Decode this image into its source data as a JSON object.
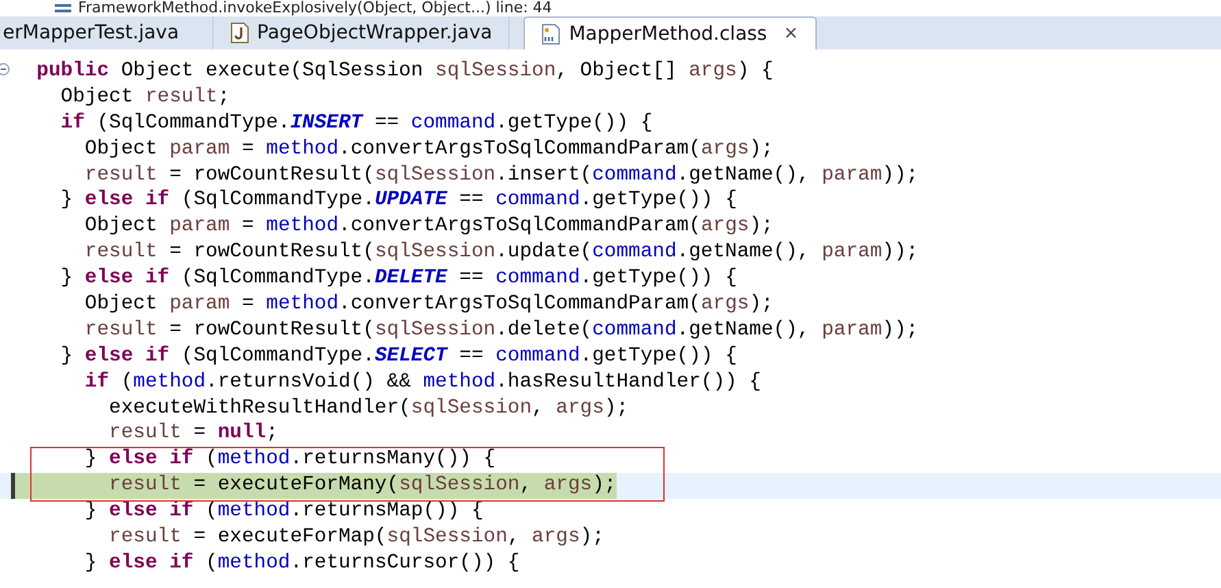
{
  "debug_frame": {
    "text": "FrameworkMethod.invokeExplosively(Object, Object...) line: 44"
  },
  "tabs": [
    {
      "label": "erMapperTest.java",
      "kind": "plain",
      "selected": false
    },
    {
      "label": "PageObjectWrapper.java",
      "kind": "java",
      "selected": false
    },
    {
      "label": "MapperMethod.class",
      "kind": "class",
      "selected": true,
      "close": "×"
    }
  ],
  "code": {
    "lines": [
      {
        "foldable": true,
        "tokens": [
          {
            "kind": "kw",
            "text": "  public"
          },
          {
            "kind": "plain",
            "text": " Object execute(SqlSession "
          },
          {
            "kind": "local",
            "text": "sqlSession"
          },
          {
            "kind": "plain",
            "text": ", Object[] "
          },
          {
            "kind": "local",
            "text": "args"
          },
          {
            "kind": "plain",
            "text": ") {"
          }
        ]
      },
      {
        "tokens": [
          {
            "kind": "plain",
            "text": "    Object "
          },
          {
            "kind": "local",
            "text": "result"
          },
          {
            "kind": "plain",
            "text": ";"
          }
        ]
      },
      {
        "tokens": [
          {
            "kind": "kw",
            "text": "    if"
          },
          {
            "kind": "plain",
            "text": " (SqlCommandType."
          },
          {
            "kind": "const",
            "text": "INSERT"
          },
          {
            "kind": "plain",
            "text": " == "
          },
          {
            "kind": "field",
            "text": "command"
          },
          {
            "kind": "plain",
            "text": ".getType()) {"
          }
        ]
      },
      {
        "tokens": [
          {
            "kind": "plain",
            "text": "      Object "
          },
          {
            "kind": "local",
            "text": "param"
          },
          {
            "kind": "plain",
            "text": " = "
          },
          {
            "kind": "field",
            "text": "method"
          },
          {
            "kind": "plain",
            "text": ".convertArgsToSqlCommandParam("
          },
          {
            "kind": "local",
            "text": "args"
          },
          {
            "kind": "plain",
            "text": ");"
          }
        ]
      },
      {
        "tokens": [
          {
            "kind": "local",
            "text": "      result"
          },
          {
            "kind": "plain",
            "text": " = rowCountResult("
          },
          {
            "kind": "local",
            "text": "sqlSession"
          },
          {
            "kind": "plain",
            "text": ".insert("
          },
          {
            "kind": "field",
            "text": "command"
          },
          {
            "kind": "plain",
            "text": ".getName(), "
          },
          {
            "kind": "local",
            "text": "param"
          },
          {
            "kind": "plain",
            "text": "));"
          }
        ]
      },
      {
        "tokens": [
          {
            "kind": "plain",
            "text": "    } "
          },
          {
            "kind": "kw",
            "text": "else if"
          },
          {
            "kind": "plain",
            "text": " (SqlCommandType."
          },
          {
            "kind": "const",
            "text": "UPDATE"
          },
          {
            "kind": "plain",
            "text": " == "
          },
          {
            "kind": "field",
            "text": "command"
          },
          {
            "kind": "plain",
            "text": ".getType()) {"
          }
        ]
      },
      {
        "tokens": [
          {
            "kind": "plain",
            "text": "      Object "
          },
          {
            "kind": "local",
            "text": "param"
          },
          {
            "kind": "plain",
            "text": " = "
          },
          {
            "kind": "field",
            "text": "method"
          },
          {
            "kind": "plain",
            "text": ".convertArgsToSqlCommandParam("
          },
          {
            "kind": "local",
            "text": "args"
          },
          {
            "kind": "plain",
            "text": ");"
          }
        ]
      },
      {
        "tokens": [
          {
            "kind": "local",
            "text": "      result"
          },
          {
            "kind": "plain",
            "text": " = rowCountResult("
          },
          {
            "kind": "local",
            "text": "sqlSession"
          },
          {
            "kind": "plain",
            "text": ".update("
          },
          {
            "kind": "field",
            "text": "command"
          },
          {
            "kind": "plain",
            "text": ".getName(), "
          },
          {
            "kind": "local",
            "text": "param"
          },
          {
            "kind": "plain",
            "text": "));"
          }
        ]
      },
      {
        "tokens": [
          {
            "kind": "plain",
            "text": "    } "
          },
          {
            "kind": "kw",
            "text": "else if"
          },
          {
            "kind": "plain",
            "text": " (SqlCommandType."
          },
          {
            "kind": "const",
            "text": "DELETE"
          },
          {
            "kind": "plain",
            "text": " == "
          },
          {
            "kind": "field",
            "text": "command"
          },
          {
            "kind": "plain",
            "text": ".getType()) {"
          }
        ]
      },
      {
        "tokens": [
          {
            "kind": "plain",
            "text": "      Object "
          },
          {
            "kind": "local",
            "text": "param"
          },
          {
            "kind": "plain",
            "text": " = "
          },
          {
            "kind": "field",
            "text": "method"
          },
          {
            "kind": "plain",
            "text": ".convertArgsToSqlCommandParam("
          },
          {
            "kind": "local",
            "text": "args"
          },
          {
            "kind": "plain",
            "text": ");"
          }
        ]
      },
      {
        "tokens": [
          {
            "kind": "local",
            "text": "      result"
          },
          {
            "kind": "plain",
            "text": " = rowCountResult("
          },
          {
            "kind": "local",
            "text": "sqlSession"
          },
          {
            "kind": "plain",
            "text": ".delete("
          },
          {
            "kind": "field",
            "text": "command"
          },
          {
            "kind": "plain",
            "text": ".getName(), "
          },
          {
            "kind": "local",
            "text": "param"
          },
          {
            "kind": "plain",
            "text": "));"
          }
        ]
      },
      {
        "tokens": [
          {
            "kind": "plain",
            "text": "    } "
          },
          {
            "kind": "kw",
            "text": "else if"
          },
          {
            "kind": "plain",
            "text": " (SqlCommandType."
          },
          {
            "kind": "const",
            "text": "SELECT"
          },
          {
            "kind": "plain",
            "text": " == "
          },
          {
            "kind": "field",
            "text": "command"
          },
          {
            "kind": "plain",
            "text": ".getType()) {"
          }
        ]
      },
      {
        "tokens": [
          {
            "kind": "kw",
            "text": "      if"
          },
          {
            "kind": "plain",
            "text": " ("
          },
          {
            "kind": "field",
            "text": "method"
          },
          {
            "kind": "plain",
            "text": ".returnsVoid() && "
          },
          {
            "kind": "field",
            "text": "method"
          },
          {
            "kind": "plain",
            "text": ".hasResultHandler()) {"
          }
        ]
      },
      {
        "tokens": [
          {
            "kind": "plain",
            "text": "        executeWithResultHandler("
          },
          {
            "kind": "local",
            "text": "sqlSession"
          },
          {
            "kind": "plain",
            "text": ", "
          },
          {
            "kind": "local",
            "text": "args"
          },
          {
            "kind": "plain",
            "text": ");"
          }
        ]
      },
      {
        "tokens": [
          {
            "kind": "local",
            "text": "        result"
          },
          {
            "kind": "plain",
            "text": " = "
          },
          {
            "kind": "kw",
            "text": "null"
          },
          {
            "kind": "plain",
            "text": ";"
          }
        ]
      },
      {
        "boxed": true,
        "tokens": [
          {
            "kind": "plain",
            "text": "      } "
          },
          {
            "kind": "kw",
            "text": "else if"
          },
          {
            "kind": "plain",
            "text": " ("
          },
          {
            "kind": "field",
            "text": "method"
          },
          {
            "kind": "plain",
            "text": ".returnsMany()) {"
          }
        ]
      },
      {
        "boxed": true,
        "current": true,
        "tokens": [
          {
            "kind": "local",
            "text": "        result"
          },
          {
            "kind": "plain",
            "text": " = executeForMany("
          },
          {
            "kind": "local",
            "text": "sqlSession"
          },
          {
            "kind": "plain",
            "text": ", "
          },
          {
            "kind": "local",
            "text": "args"
          },
          {
            "kind": "plain",
            "text": ");"
          }
        ]
      },
      {
        "tokens": [
          {
            "kind": "plain",
            "text": "      } "
          },
          {
            "kind": "kw",
            "text": "else if"
          },
          {
            "kind": "plain",
            "text": " ("
          },
          {
            "kind": "field",
            "text": "method"
          },
          {
            "kind": "plain",
            "text": ".returnsMap()) {"
          }
        ]
      },
      {
        "tokens": [
          {
            "kind": "local",
            "text": "        result"
          },
          {
            "kind": "plain",
            "text": " = executeForMap("
          },
          {
            "kind": "local",
            "text": "sqlSession"
          },
          {
            "kind": "plain",
            "text": ", "
          },
          {
            "kind": "local",
            "text": "args"
          },
          {
            "kind": "plain",
            "text": ");"
          }
        ]
      },
      {
        "tokens": [
          {
            "kind": "plain",
            "text": "      } "
          },
          {
            "kind": "kw",
            "text": "else if"
          },
          {
            "kind": "plain",
            "text": " ("
          },
          {
            "kind": "field",
            "text": "method"
          },
          {
            "kind": "plain",
            "text": ".returnsCursor()) {"
          }
        ]
      }
    ]
  }
}
